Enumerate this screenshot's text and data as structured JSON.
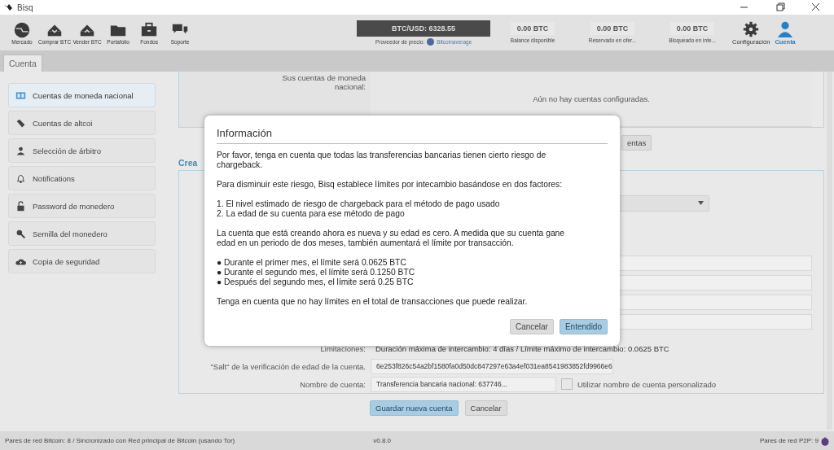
{
  "window": {
    "title": "Bisq"
  },
  "toolbar": {
    "nav": [
      {
        "label": "Mercado",
        "selected": false
      },
      {
        "label": "Comprar BTC",
        "selected": false
      },
      {
        "label": "Vender BTC",
        "selected": false
      },
      {
        "label": "Portafolio",
        "selected": false
      },
      {
        "label": "Fondos",
        "selected": false
      },
      {
        "label": "Soporte",
        "selected": false
      }
    ],
    "price": {
      "value": "BTC/USD: 6328.55",
      "provider_label": "Proveedor de precio:",
      "provider": "Bitcoinaverage"
    },
    "balances": [
      {
        "value": "0.00 BTC",
        "label": "Balance disponible"
      },
      {
        "value": "0.00 BTC",
        "label": "Reservado en ofer..."
      },
      {
        "value": "0.00 BTC",
        "label": "Bloqueado en inte..."
      }
    ],
    "right": [
      {
        "label": "Configuración",
        "selected": false
      },
      {
        "label": "Cuenta",
        "selected": true
      }
    ]
  },
  "tabs": [
    {
      "label": "Cuenta",
      "selected": true
    }
  ],
  "sidebar": {
    "items": [
      {
        "label": "Cuentas de moneda nacional",
        "selected": true
      },
      {
        "label": "Cuentas de altcoi",
        "selected": false
      },
      {
        "label": "Selección de árbitro",
        "selected": false
      },
      {
        "label": "Notifications",
        "selected": false
      },
      {
        "label": "Password de monedero",
        "selected": false
      },
      {
        "label": "Semilla del monedero",
        "selected": false
      },
      {
        "label": "Copia de seguridad",
        "selected": false
      }
    ]
  },
  "accounts": {
    "label": "Sus cuentas de moneda nacional:",
    "empty": "Aún no hay cuentas configuradas.",
    "button": "entas"
  },
  "create": {
    "title": "Crea",
    "rows": [
      {
        "label": "Limitaciones:",
        "value": "Duración máxima de intercambio: 4 días / Límite máximo de intercambio: 0.0625 BTC",
        "kind": "text"
      },
      {
        "label": "\"Salt\" de la verificación de edad de la cuenta.",
        "value": "6e253f826c54a2bf1580fa0d50dc847297e63a4ef031ea8541983852fd9966e6",
        "kind": "field"
      },
      {
        "label": "Nombre de cuenta:",
        "value": "Transferencia bancaria nacional: 637746...",
        "kind": "field",
        "checkbox": {
          "label": "Utilizar nombre de cuenta personalizado",
          "checked": false
        }
      }
    ],
    "buttons": [
      {
        "label": "Guardar nueva cuenta",
        "primary": true
      },
      {
        "label": "Cancelar",
        "primary": false
      }
    ]
  },
  "dialog": {
    "title": "Información",
    "paragraphs": [
      {
        "kind": "text",
        "text": "Por favor, tenga en cuenta que todas las transferencias bancarias tienen cierto riesgo de chargeback."
      },
      {
        "kind": "text",
        "text": "Para disminuir este riesgo, Bisq establece límites por intecambio basándose en dos factores:"
      },
      {
        "kind": "list",
        "items": [
          "1. El nivel estimado de riesgo de chargeback para el método de pago usado",
          "2. La edad de su cuenta para ese método de pago"
        ]
      },
      {
        "kind": "text",
        "text": "La cuenta que está creando ahora es nueva y su edad es cero. A medida que su cuenta gane edad en un periodo de dos meses, también aumentará el límite por transacción."
      },
      {
        "kind": "list",
        "items": [
          "● Durante el primer mes, el límite será 0.0625 BTC",
          "● Durante el segundo mes, el límite será 0.1250 BTC",
          "● Después del segundo mes, el límite será  0.25 BTC"
        ]
      },
      {
        "kind": "text",
        "text": "Tenga en cuenta que no hay límites en el total de transacciones que puede realizar."
      }
    ],
    "buttons": [
      {
        "label": "Cancelar",
        "primary": false
      },
      {
        "label": "Entendido",
        "primary": true
      }
    ]
  },
  "status_bar": {
    "left": "Pares de red Bitcoin: 8 / Sincronizado con Red principal de Bitcoin (usando Tor)",
    "version": "v0.8.0",
    "right": "Pares de red P2P: 9"
  }
}
